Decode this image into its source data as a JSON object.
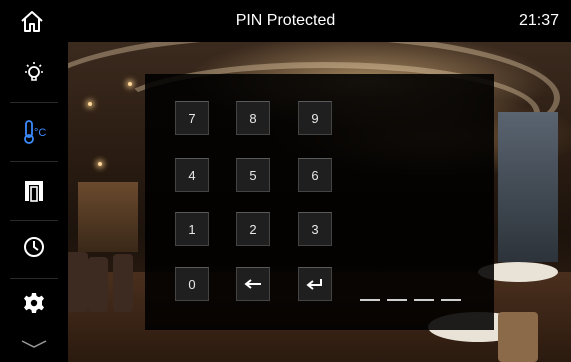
{
  "header": {
    "title": "PIN Protected",
    "time": "21:37",
    "home_icon": "home-icon"
  },
  "sidebar": {
    "items": [
      {
        "name": "lighting",
        "icon": "lightbulb-icon",
        "active": false
      },
      {
        "name": "climate",
        "icon": "thermometer-celsius-icon",
        "label": "°C",
        "active": true
      },
      {
        "name": "blinds",
        "icon": "shutter-icon",
        "active": false
      },
      {
        "name": "scheduler",
        "icon": "clock-icon",
        "active": false
      },
      {
        "name": "settings",
        "icon": "gear-icon",
        "active": false
      }
    ],
    "more_icon": "chevron-down-icon"
  },
  "keypad": {
    "keys": [
      "7",
      "8",
      "9",
      "4",
      "5",
      "6",
      "1",
      "2",
      "3",
      "0"
    ],
    "backspace_icon": "backspace-arrow-icon",
    "enter_icon": "enter-icon",
    "pin_slots": 4
  },
  "colors": {
    "accent": "#3d8bff",
    "bar_bg": "#000000",
    "key_bg": "#1f1f1f",
    "text": "#ffffff"
  }
}
